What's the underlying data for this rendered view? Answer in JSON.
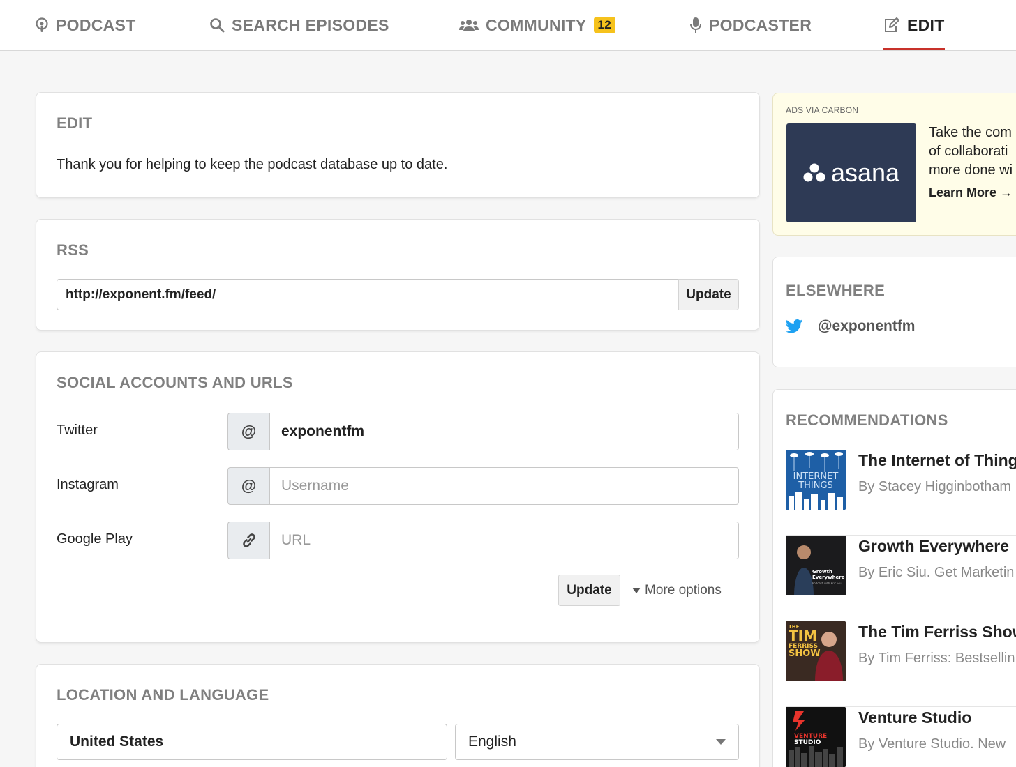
{
  "nav": {
    "items": [
      {
        "label": "PODCAST",
        "icon": "podcast-icon"
      },
      {
        "label": "SEARCH EPISODES",
        "icon": "search-icon"
      },
      {
        "label": "COMMUNITY",
        "icon": "users-icon",
        "badge": "12"
      },
      {
        "label": "PODCASTER",
        "icon": "microphone-icon"
      },
      {
        "label": "EDIT",
        "icon": "edit-icon",
        "active": true
      }
    ]
  },
  "edit_card": {
    "title": "EDIT",
    "text": "Thank you for helping to keep the podcast database up to date."
  },
  "rss_card": {
    "title": "RSS",
    "value": "http://exponent.fm/feed/",
    "button": "Update"
  },
  "social_card": {
    "title": "SOCIAL ACCOUNTS AND URLS",
    "fields": [
      {
        "label": "Twitter",
        "addon": "@",
        "value": "exponentfm",
        "placeholder": ""
      },
      {
        "label": "Instagram",
        "addon": "@",
        "value": "",
        "placeholder": "Username"
      },
      {
        "label": "Google Play",
        "addon": "link-icon",
        "value": "",
        "placeholder": "URL"
      }
    ],
    "update_button": "Update",
    "more_options": "More options"
  },
  "location_card": {
    "title": "LOCATION AND LANGUAGE",
    "country": "United States",
    "language": "English"
  },
  "ad": {
    "via": "ADS VIA CARBON",
    "brand": "asana",
    "text": [
      "Take the com",
      "of collaborati",
      "more done wi"
    ],
    "cta": "Learn More →"
  },
  "elsewhere": {
    "title": "ELSEWHERE",
    "twitter": "@exponentfm"
  },
  "recommendations": {
    "title": "RECOMMENDATIONS",
    "items": [
      {
        "title": "The Internet of Thing",
        "by": "By Stacey Higginbotham"
      },
      {
        "title": "Growth Everywhere",
        "by": "By Eric Siu. Get Marketin"
      },
      {
        "title": "The Tim Ferriss Show",
        "by": "By Tim Ferriss: Bestsellin"
      },
      {
        "title": "Venture Studio",
        "by": "By Venture Studio. New"
      }
    ]
  },
  "colors": {
    "accent": "#c8312a",
    "badge": "#f6c21c",
    "twitter": "#1da1f2",
    "asana": "#2e3a55"
  }
}
